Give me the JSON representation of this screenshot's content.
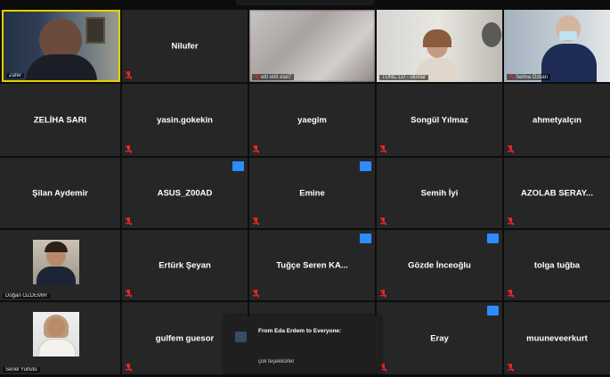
{
  "participants": [
    {
      "name": "",
      "label": "Zafer"
    },
    {
      "name": "Nilufer",
      "label": ""
    },
    {
      "name": "",
      "label": "etti ettit etat7"
    },
    {
      "name": "",
      "label": "TUNC LU - uluslar"
    },
    {
      "name": "",
      "label": "Selma Özkan"
    },
    {
      "name": "ZELİHA SARI",
      "label": ""
    },
    {
      "name": "yasin.gokekin",
      "label": ""
    },
    {
      "name": "yaegim",
      "label": ""
    },
    {
      "name": "Songül Yılmaz",
      "label": ""
    },
    {
      "name": "ahmetyalçın",
      "label": ""
    },
    {
      "name": "Şilan Aydemir",
      "label": ""
    },
    {
      "name": "ASUS_Z00AD",
      "label": ""
    },
    {
      "name": "Emine",
      "label": ""
    },
    {
      "name": "Semih İyi",
      "label": ""
    },
    {
      "name": "AZOLAB SERAY...",
      "label": ""
    },
    {
      "name": "",
      "label": "Doğan ÖZDEMİR"
    },
    {
      "name": "Ertürk Şeyan",
      "label": ""
    },
    {
      "name": "Tuğçe Seren KA...",
      "label": ""
    },
    {
      "name": "Gözde İnceoğlu",
      "label": ""
    },
    {
      "name": "tolga tuğba",
      "label": ""
    },
    {
      "name": "",
      "label": "Senel Yurlutu"
    },
    {
      "name": "gulfem guesor",
      "label": ""
    },
    {
      "name": "",
      "label": ""
    },
    {
      "name": "Eray",
      "label": ""
    },
    {
      "name": "muuneveerkurt",
      "label": ""
    }
  ],
  "chat_notification": {
    "from": "From Eda Erdem to Everyone:",
    "message": "çok teşekkürler"
  },
  "colors": {
    "tile_bg": "#262626",
    "active_border": "#e6d000",
    "badge": "#2d8cff",
    "mute": "#e02828"
  }
}
